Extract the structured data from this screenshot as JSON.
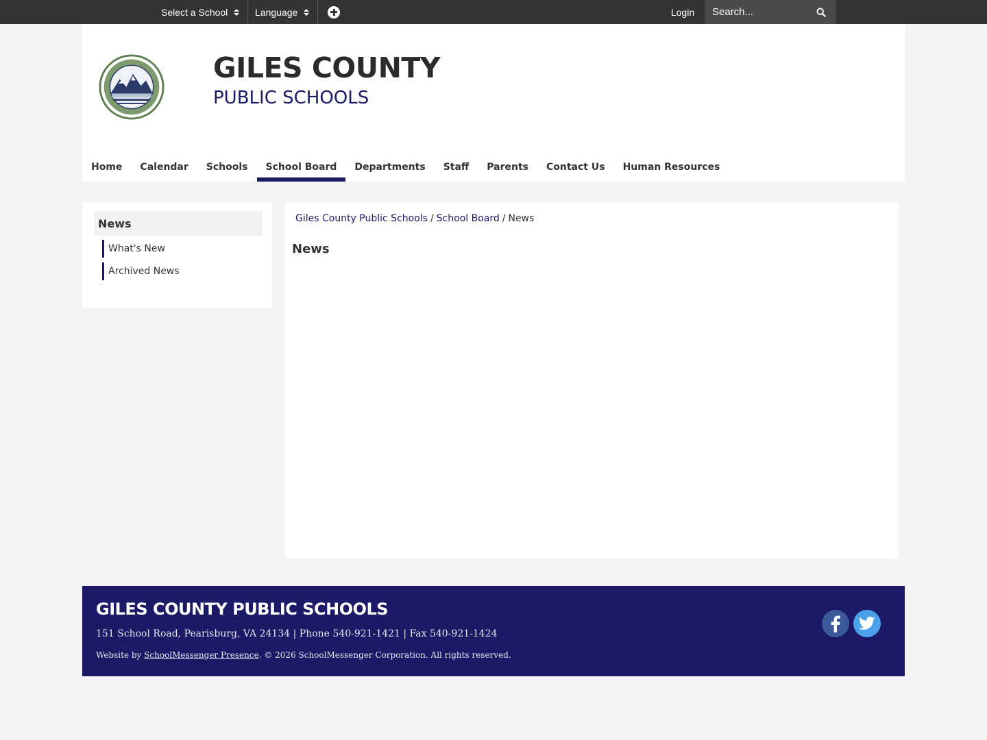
{
  "topbar": {
    "select_school": "Select a School",
    "language": "Language",
    "login": "Login",
    "search_placeholder": "Search..."
  },
  "header": {
    "title": "GILES COUNTY",
    "subtitle": "PUBLIC SCHOOLS",
    "logo_icon": "school-seal-logo"
  },
  "nav": {
    "items": [
      {
        "label": "Home"
      },
      {
        "label": "Calendar"
      },
      {
        "label": "Schools"
      },
      {
        "label": "School Board",
        "active": true
      },
      {
        "label": "Departments"
      },
      {
        "label": "Staff"
      },
      {
        "label": "Parents"
      },
      {
        "label": "Contact Us"
      },
      {
        "label": "Human Resources"
      }
    ]
  },
  "sidebar": {
    "heading": "News",
    "links": [
      {
        "label": "What's New"
      },
      {
        "label": "Archived News"
      }
    ]
  },
  "main": {
    "breadcrumb": [
      "Giles County Public Schools",
      "School Board",
      "News"
    ],
    "breadcrumb_separator": "/",
    "title": "News"
  },
  "footer": {
    "title": "GILES COUNTY PUBLIC SCHOOLS",
    "address": "151 School Road, Pearisburg, VA 24134 | Phone 540-921-1421 | Fax 540-921-1424",
    "credit_prefix": "Website by ",
    "credit_link": "SchoolMessenger Presence",
    "copyright": ". © 2026 SchoolMessenger Corporation. All rights reserved.",
    "social": [
      "facebook-icon",
      "twitter-icon"
    ]
  },
  "colors": {
    "topbar": "#333333",
    "brand_navy": "#1c1a66",
    "page_bg": "#f4f4f4",
    "facebook": "#3b5998",
    "twitter": "#4aa0ea"
  }
}
